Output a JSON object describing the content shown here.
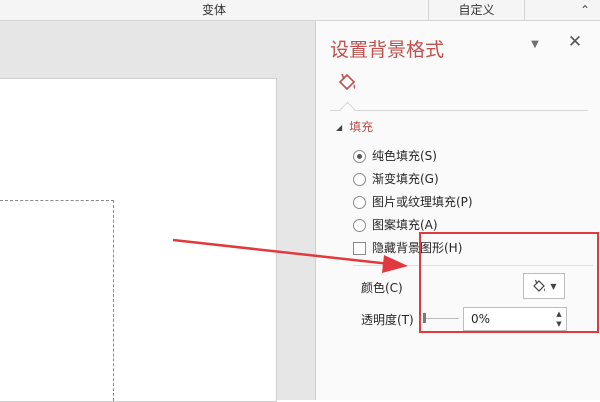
{
  "ribbon": {
    "group_variants": "变体",
    "group_customize": "自定义",
    "collapse_glyph": "⌃"
  },
  "pane": {
    "title": "设置背景格式",
    "menu_glyph": "▼",
    "close_glyph": "✕",
    "fill_section": {
      "label": "填充",
      "expand_glyph": "◢"
    },
    "fill_options": [
      {
        "label": "纯色填充(S)",
        "selected": true
      },
      {
        "label": "渐变填充(G)",
        "selected": false
      },
      {
        "label": "图片或纹理填充(P)",
        "selected": false
      },
      {
        "label": "图案填充(A)",
        "selected": false
      }
    ],
    "hide_graphics": {
      "label": "隐藏背景图形(H)",
      "checked": false
    },
    "color": {
      "label": "颜色(C)",
      "icon": "paint-bucket-icon"
    },
    "transparency": {
      "label": "透明度(T)",
      "value": "0%",
      "fraction": 0
    }
  },
  "colors": {
    "accent": "#c0504d",
    "annotation": "#e03a3e",
    "workarea": "#e6e6e6",
    "pane_bg": "#fafafa"
  }
}
